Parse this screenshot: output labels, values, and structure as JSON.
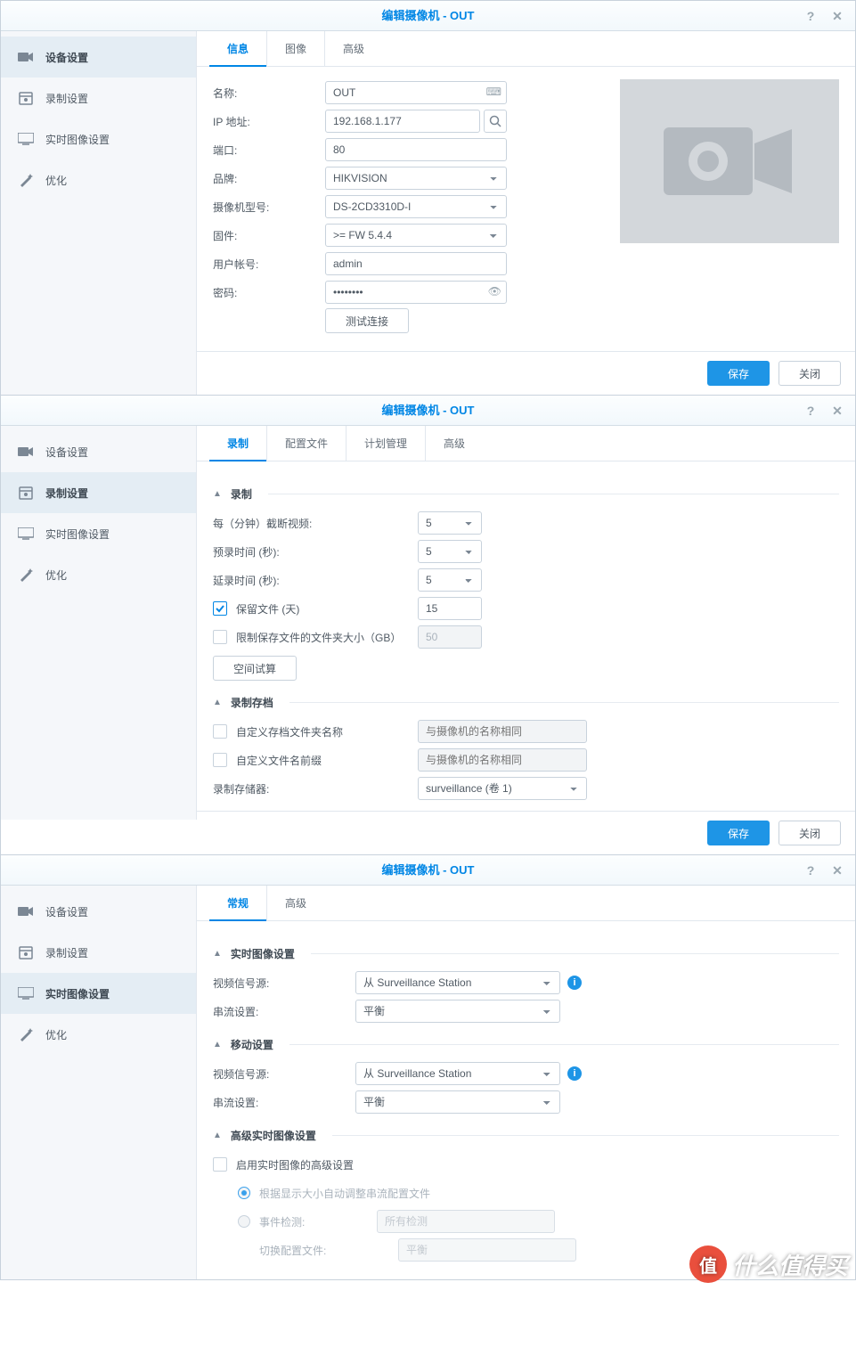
{
  "title": "编辑摄像机 - OUT",
  "sidebar": {
    "device": "设备设置",
    "record": "录制设置",
    "live": "实时图像设置",
    "opt": "优化"
  },
  "btn": {
    "save": "保存",
    "close": "关闭",
    "test": "测试连接",
    "space": "空间试算"
  },
  "d1": {
    "tabs": {
      "info": "信息",
      "image": "图像",
      "adv": "高级"
    },
    "labels": {
      "name": "名称:",
      "ip": "IP 地址:",
      "port": "端口:",
      "brand": "品牌:",
      "model": "摄像机型号:",
      "fw": "固件:",
      "user": "用户帐号:",
      "pwd": "密码:"
    },
    "vals": {
      "name": "OUT",
      "ip": "192.168.1.177",
      "port": "80",
      "brand": "HIKVISION",
      "model": "DS-2CD3310D-I",
      "fw": ">= FW 5.4.4",
      "user": "admin",
      "pwd": "••••••••"
    }
  },
  "d2": {
    "tabs": {
      "rec": "录制",
      "profile": "配置文件",
      "schedule": "计划管理",
      "adv": "高级"
    },
    "sec": {
      "rec": "录制",
      "arc": "录制存档"
    },
    "labels": {
      "trunc": "每（分钟）截断视频:",
      "pre": "预录时间 (秒):",
      "post": "延录时间 (秒):",
      "keep": "保留文件 (天)",
      "limit": "限制保存文件的文件夹大小（GB）",
      "custfolder": "自定义存档文件夹名称",
      "custprefix": "自定义文件名前缀",
      "storage": "录制存储器:"
    },
    "vals": {
      "trunc": "5",
      "pre": "5",
      "post": "5",
      "keep": "15",
      "limit": "50",
      "storage": "surveillance (卷 1)"
    },
    "ph": {
      "same": "与摄像机的名称相同"
    }
  },
  "d3": {
    "tabs": {
      "general": "常规",
      "adv": "高级"
    },
    "sec": {
      "live": "实时图像设置",
      "mobile": "移动设置",
      "advlive": "高级实时图像设置"
    },
    "labels": {
      "src": "视频信号源:",
      "stream": "串流设置:",
      "enable": "启用实时图像的高级设置",
      "auto": "根据显示大小自动调整串流配置文件",
      "event": "事件检测:",
      "switch": "切换配置文件:"
    },
    "vals": {
      "src": "从 Surveillance Station",
      "stream": "平衡",
      "allevt": "所有检测"
    }
  },
  "watermark": "什么值得买"
}
